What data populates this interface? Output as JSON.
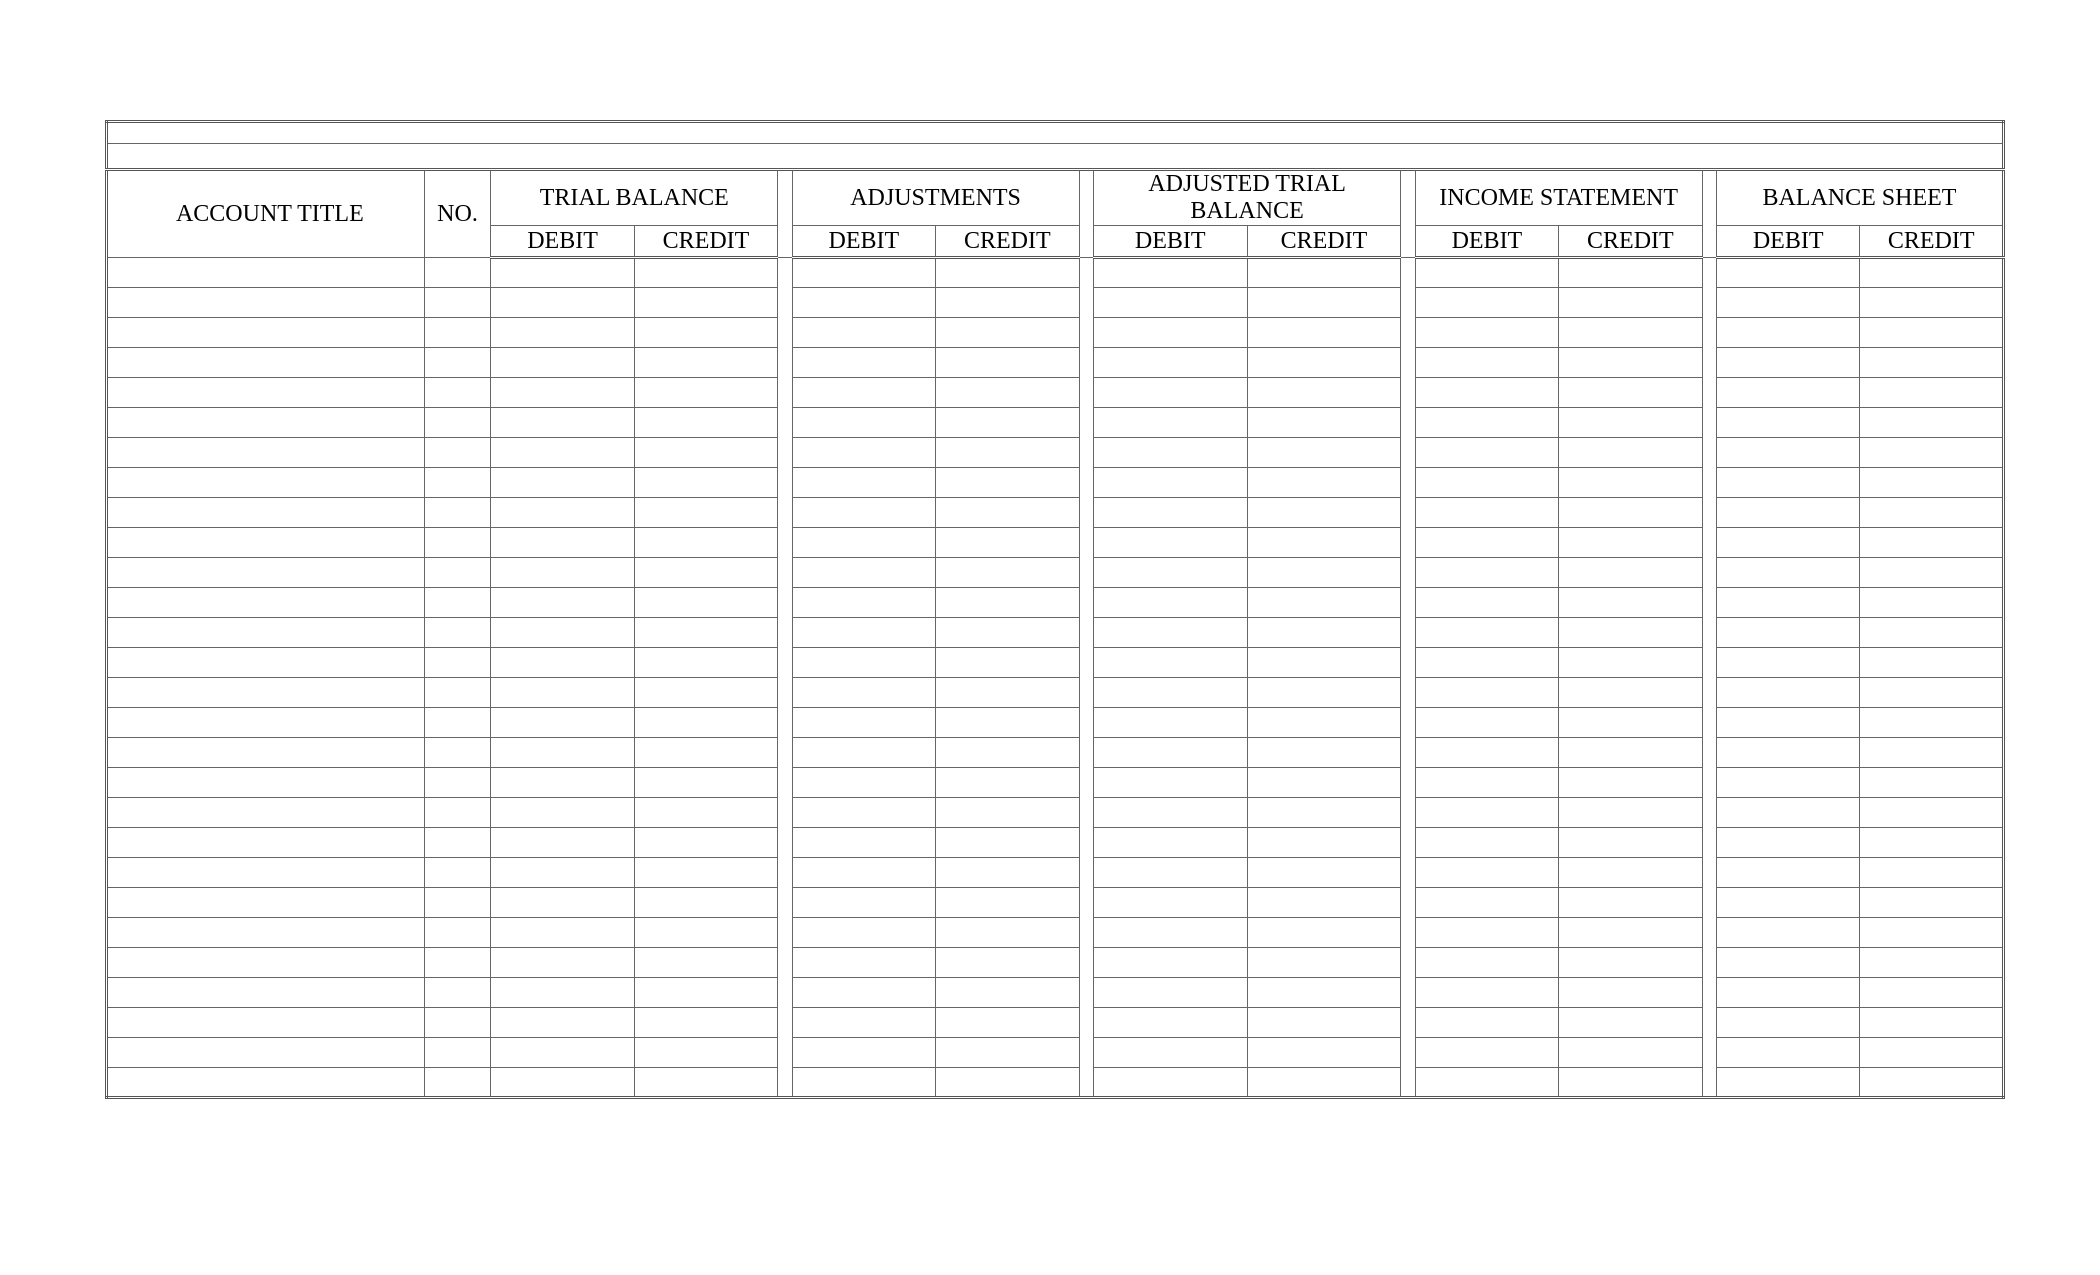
{
  "header": {
    "account_title": "ACCOUNT TITLE",
    "no": "NO.",
    "sections": {
      "trial_balance": "TRIAL BALANCE",
      "adjustments": "ADJUSTMENTS",
      "adjusted_trial_balance": "ADJUSTED TRIAL BALANCE",
      "income_statement": "INCOME STATEMENT",
      "balance_sheet": "BALANCE SHEET"
    },
    "debit": "DEBIT",
    "credit": "CREDIT"
  },
  "rows": [
    {
      "account_title": "",
      "no": "",
      "trial_balance": {
        "debit": "",
        "credit": ""
      },
      "adjustments": {
        "debit": "",
        "credit": ""
      },
      "adjusted_trial_balance": {
        "debit": "",
        "credit": ""
      },
      "income_statement": {
        "debit": "",
        "credit": ""
      },
      "balance_sheet": {
        "debit": "",
        "credit": ""
      }
    },
    {
      "account_title": "",
      "no": "",
      "trial_balance": {
        "debit": "",
        "credit": ""
      },
      "adjustments": {
        "debit": "",
        "credit": ""
      },
      "adjusted_trial_balance": {
        "debit": "",
        "credit": ""
      },
      "income_statement": {
        "debit": "",
        "credit": ""
      },
      "balance_sheet": {
        "debit": "",
        "credit": ""
      }
    },
    {
      "account_title": "",
      "no": "",
      "trial_balance": {
        "debit": "",
        "credit": ""
      },
      "adjustments": {
        "debit": "",
        "credit": ""
      },
      "adjusted_trial_balance": {
        "debit": "",
        "credit": ""
      },
      "income_statement": {
        "debit": "",
        "credit": ""
      },
      "balance_sheet": {
        "debit": "",
        "credit": ""
      }
    },
    {
      "account_title": "",
      "no": "",
      "trial_balance": {
        "debit": "",
        "credit": ""
      },
      "adjustments": {
        "debit": "",
        "credit": ""
      },
      "adjusted_trial_balance": {
        "debit": "",
        "credit": ""
      },
      "income_statement": {
        "debit": "",
        "credit": ""
      },
      "balance_sheet": {
        "debit": "",
        "credit": ""
      }
    },
    {
      "account_title": "",
      "no": "",
      "trial_balance": {
        "debit": "",
        "credit": ""
      },
      "adjustments": {
        "debit": "",
        "credit": ""
      },
      "adjusted_trial_balance": {
        "debit": "",
        "credit": ""
      },
      "income_statement": {
        "debit": "",
        "credit": ""
      },
      "balance_sheet": {
        "debit": "",
        "credit": ""
      }
    },
    {
      "account_title": "",
      "no": "",
      "trial_balance": {
        "debit": "",
        "credit": ""
      },
      "adjustments": {
        "debit": "",
        "credit": ""
      },
      "adjusted_trial_balance": {
        "debit": "",
        "credit": ""
      },
      "income_statement": {
        "debit": "",
        "credit": ""
      },
      "balance_sheet": {
        "debit": "",
        "credit": ""
      }
    },
    {
      "account_title": "",
      "no": "",
      "trial_balance": {
        "debit": "",
        "credit": ""
      },
      "adjustments": {
        "debit": "",
        "credit": ""
      },
      "adjusted_trial_balance": {
        "debit": "",
        "credit": ""
      },
      "income_statement": {
        "debit": "",
        "credit": ""
      },
      "balance_sheet": {
        "debit": "",
        "credit": ""
      }
    },
    {
      "account_title": "",
      "no": "",
      "trial_balance": {
        "debit": "",
        "credit": ""
      },
      "adjustments": {
        "debit": "",
        "credit": ""
      },
      "adjusted_trial_balance": {
        "debit": "",
        "credit": ""
      },
      "income_statement": {
        "debit": "",
        "credit": ""
      },
      "balance_sheet": {
        "debit": "",
        "credit": ""
      }
    },
    {
      "account_title": "",
      "no": "",
      "trial_balance": {
        "debit": "",
        "credit": ""
      },
      "adjustments": {
        "debit": "",
        "credit": ""
      },
      "adjusted_trial_balance": {
        "debit": "",
        "credit": ""
      },
      "income_statement": {
        "debit": "",
        "credit": ""
      },
      "balance_sheet": {
        "debit": "",
        "credit": ""
      }
    },
    {
      "account_title": "",
      "no": "",
      "trial_balance": {
        "debit": "",
        "credit": ""
      },
      "adjustments": {
        "debit": "",
        "credit": ""
      },
      "adjusted_trial_balance": {
        "debit": "",
        "credit": ""
      },
      "income_statement": {
        "debit": "",
        "credit": ""
      },
      "balance_sheet": {
        "debit": "",
        "credit": ""
      }
    },
    {
      "account_title": "",
      "no": "",
      "trial_balance": {
        "debit": "",
        "credit": ""
      },
      "adjustments": {
        "debit": "",
        "credit": ""
      },
      "adjusted_trial_balance": {
        "debit": "",
        "credit": ""
      },
      "income_statement": {
        "debit": "",
        "credit": ""
      },
      "balance_sheet": {
        "debit": "",
        "credit": ""
      }
    },
    {
      "account_title": "",
      "no": "",
      "trial_balance": {
        "debit": "",
        "credit": ""
      },
      "adjustments": {
        "debit": "",
        "credit": ""
      },
      "adjusted_trial_balance": {
        "debit": "",
        "credit": ""
      },
      "income_statement": {
        "debit": "",
        "credit": ""
      },
      "balance_sheet": {
        "debit": "",
        "credit": ""
      }
    },
    {
      "account_title": "",
      "no": "",
      "trial_balance": {
        "debit": "",
        "credit": ""
      },
      "adjustments": {
        "debit": "",
        "credit": ""
      },
      "adjusted_trial_balance": {
        "debit": "",
        "credit": ""
      },
      "income_statement": {
        "debit": "",
        "credit": ""
      },
      "balance_sheet": {
        "debit": "",
        "credit": ""
      }
    },
    {
      "account_title": "",
      "no": "",
      "trial_balance": {
        "debit": "",
        "credit": ""
      },
      "adjustments": {
        "debit": "",
        "credit": ""
      },
      "adjusted_trial_balance": {
        "debit": "",
        "credit": ""
      },
      "income_statement": {
        "debit": "",
        "credit": ""
      },
      "balance_sheet": {
        "debit": "",
        "credit": ""
      }
    },
    {
      "account_title": "",
      "no": "",
      "trial_balance": {
        "debit": "",
        "credit": ""
      },
      "adjustments": {
        "debit": "",
        "credit": ""
      },
      "adjusted_trial_balance": {
        "debit": "",
        "credit": ""
      },
      "income_statement": {
        "debit": "",
        "credit": ""
      },
      "balance_sheet": {
        "debit": "",
        "credit": ""
      }
    },
    {
      "account_title": "",
      "no": "",
      "trial_balance": {
        "debit": "",
        "credit": ""
      },
      "adjustments": {
        "debit": "",
        "credit": ""
      },
      "adjusted_trial_balance": {
        "debit": "",
        "credit": ""
      },
      "income_statement": {
        "debit": "",
        "credit": ""
      },
      "balance_sheet": {
        "debit": "",
        "credit": ""
      }
    },
    {
      "account_title": "",
      "no": "",
      "trial_balance": {
        "debit": "",
        "credit": ""
      },
      "adjustments": {
        "debit": "",
        "credit": ""
      },
      "adjusted_trial_balance": {
        "debit": "",
        "credit": ""
      },
      "income_statement": {
        "debit": "",
        "credit": ""
      },
      "balance_sheet": {
        "debit": "",
        "credit": ""
      }
    },
    {
      "account_title": "",
      "no": "",
      "trial_balance": {
        "debit": "",
        "credit": ""
      },
      "adjustments": {
        "debit": "",
        "credit": ""
      },
      "adjusted_trial_balance": {
        "debit": "",
        "credit": ""
      },
      "income_statement": {
        "debit": "",
        "credit": ""
      },
      "balance_sheet": {
        "debit": "",
        "credit": ""
      }
    },
    {
      "account_title": "",
      "no": "",
      "trial_balance": {
        "debit": "",
        "credit": ""
      },
      "adjustments": {
        "debit": "",
        "credit": ""
      },
      "adjusted_trial_balance": {
        "debit": "",
        "credit": ""
      },
      "income_statement": {
        "debit": "",
        "credit": ""
      },
      "balance_sheet": {
        "debit": "",
        "credit": ""
      }
    },
    {
      "account_title": "",
      "no": "",
      "trial_balance": {
        "debit": "",
        "credit": ""
      },
      "adjustments": {
        "debit": "",
        "credit": ""
      },
      "adjusted_trial_balance": {
        "debit": "",
        "credit": ""
      },
      "income_statement": {
        "debit": "",
        "credit": ""
      },
      "balance_sheet": {
        "debit": "",
        "credit": ""
      }
    },
    {
      "account_title": "",
      "no": "",
      "trial_balance": {
        "debit": "",
        "credit": ""
      },
      "adjustments": {
        "debit": "",
        "credit": ""
      },
      "adjusted_trial_balance": {
        "debit": "",
        "credit": ""
      },
      "income_statement": {
        "debit": "",
        "credit": ""
      },
      "balance_sheet": {
        "debit": "",
        "credit": ""
      }
    },
    {
      "account_title": "",
      "no": "",
      "trial_balance": {
        "debit": "",
        "credit": ""
      },
      "adjustments": {
        "debit": "",
        "credit": ""
      },
      "adjusted_trial_balance": {
        "debit": "",
        "credit": ""
      },
      "income_statement": {
        "debit": "",
        "credit": ""
      },
      "balance_sheet": {
        "debit": "",
        "credit": ""
      }
    },
    {
      "account_title": "",
      "no": "",
      "trial_balance": {
        "debit": "",
        "credit": ""
      },
      "adjustments": {
        "debit": "",
        "credit": ""
      },
      "adjusted_trial_balance": {
        "debit": "",
        "credit": ""
      },
      "income_statement": {
        "debit": "",
        "credit": ""
      },
      "balance_sheet": {
        "debit": "",
        "credit": ""
      }
    },
    {
      "account_title": "",
      "no": "",
      "trial_balance": {
        "debit": "",
        "credit": ""
      },
      "adjustments": {
        "debit": "",
        "credit": ""
      },
      "adjusted_trial_balance": {
        "debit": "",
        "credit": ""
      },
      "income_statement": {
        "debit": "",
        "credit": ""
      },
      "balance_sheet": {
        "debit": "",
        "credit": ""
      }
    },
    {
      "account_title": "",
      "no": "",
      "trial_balance": {
        "debit": "",
        "credit": ""
      },
      "adjustments": {
        "debit": "",
        "credit": ""
      },
      "adjusted_trial_balance": {
        "debit": "",
        "credit": ""
      },
      "income_statement": {
        "debit": "",
        "credit": ""
      },
      "balance_sheet": {
        "debit": "",
        "credit": ""
      }
    },
    {
      "account_title": "",
      "no": "",
      "trial_balance": {
        "debit": "",
        "credit": ""
      },
      "adjustments": {
        "debit": "",
        "credit": ""
      },
      "adjusted_trial_balance": {
        "debit": "",
        "credit": ""
      },
      "income_statement": {
        "debit": "",
        "credit": ""
      },
      "balance_sheet": {
        "debit": "",
        "credit": ""
      }
    },
    {
      "account_title": "",
      "no": "",
      "trial_balance": {
        "debit": "",
        "credit": ""
      },
      "adjustments": {
        "debit": "",
        "credit": ""
      },
      "adjusted_trial_balance": {
        "debit": "",
        "credit": ""
      },
      "income_statement": {
        "debit": "",
        "credit": ""
      },
      "balance_sheet": {
        "debit": "",
        "credit": ""
      }
    },
    {
      "account_title": "",
      "no": "",
      "trial_balance": {
        "debit": "",
        "credit": ""
      },
      "adjustments": {
        "debit": "",
        "credit": ""
      },
      "adjusted_trial_balance": {
        "debit": "",
        "credit": ""
      },
      "income_statement": {
        "debit": "",
        "credit": ""
      },
      "balance_sheet": {
        "debit": "",
        "credit": ""
      }
    }
  ]
}
